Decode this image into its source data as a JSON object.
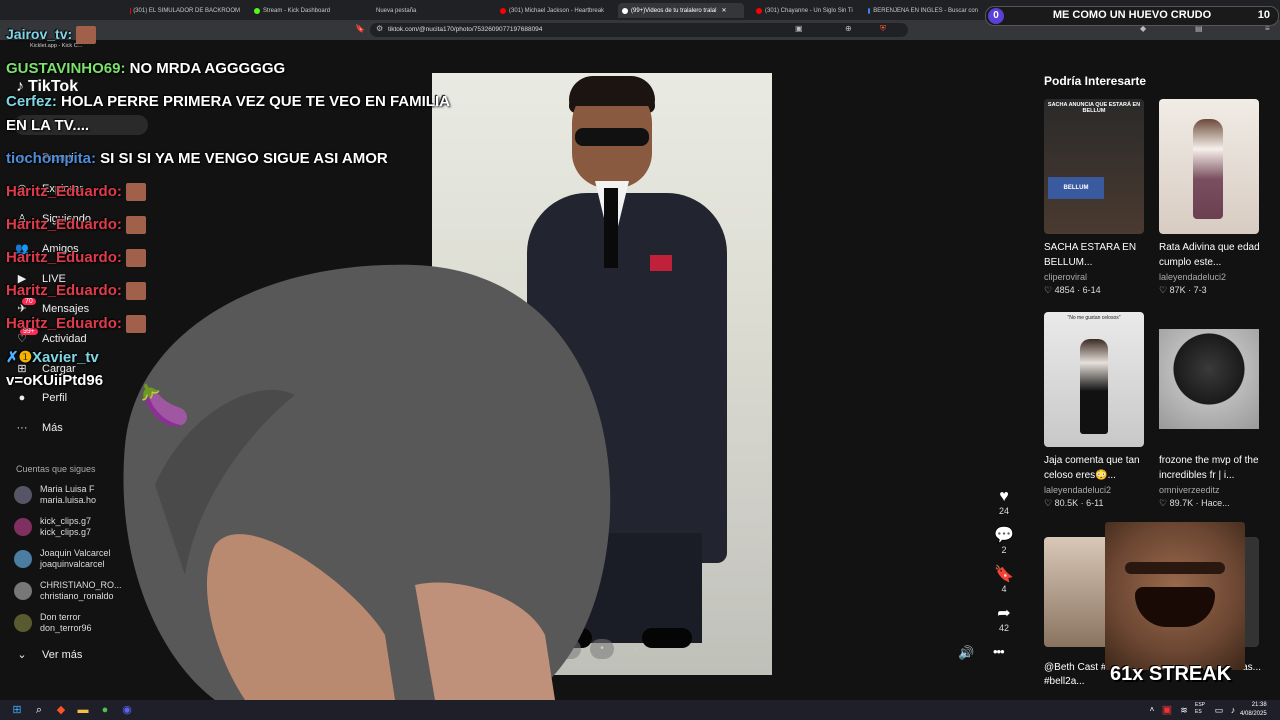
{
  "browser": {
    "tabs": [
      {
        "label": "(301) EL SIMULADOR DE BACKROOM",
        "color": "#ff0000"
      },
      {
        "label": "Stream - Kick Dashboard",
        "color": "#53fc18"
      },
      {
        "label": "Nueva pestaña",
        "color": "#888888"
      },
      {
        "label": "(301) Michael Jackson - Heartbreak",
        "color": "#ff0000"
      },
      {
        "label": "(99+)Videos de tu tralalero tralal",
        "color": "#ffffff"
      },
      {
        "label": "(301) Chayanne - Un Siglo Sin Ti",
        "color": "#ff0000"
      },
      {
        "label": "BERENJENA EN INGLES - Buscar con",
        "color": "#4285f4"
      }
    ],
    "url": "tiktok.com/@nucita170/photo/7532609077197688094"
  },
  "tiktok": {
    "logo": "TikTok",
    "nav": [
      {
        "label": "Para ti",
        "icon": "home-icon"
      },
      {
        "label": "Explorar",
        "icon": "compass-icon"
      },
      {
        "label": "Siguiendo",
        "icon": "following-icon"
      },
      {
        "label": "Amigos",
        "icon": "friends-icon"
      },
      {
        "label": "LIVE",
        "icon": "live-icon"
      },
      {
        "label": "Mensajes",
        "icon": "messages-icon",
        "badge": "70"
      },
      {
        "label": "Actividad",
        "icon": "activity-icon",
        "badge": "99+"
      },
      {
        "label": "Cargar",
        "icon": "upload-icon"
      },
      {
        "label": "Perfil",
        "icon": "profile-icon"
      },
      {
        "label": "Más",
        "icon": "more-icon"
      }
    ],
    "following_title": "Cuentas que sigues",
    "following": [
      {
        "name": "Maria Luisa F",
        "handle": "maria.luisa.ho"
      },
      {
        "name": "kick_clips.g7",
        "handle": "kick_clips.g7"
      },
      {
        "name": "Joaquin Valcarcel",
        "handle": "joaquinvalcarcel"
      },
      {
        "name": "CHRISTIANO_RO...",
        "handle": "christiano_ronaldo"
      },
      {
        "name": "Don terror",
        "handle": "don_terror96"
      }
    ],
    "see_more": "Ver más",
    "actions": {
      "likes": "24",
      "comments": "2",
      "saves": "4",
      "shares": "42"
    },
    "recommend_title": "Podría Interesarte",
    "cards": [
      {
        "title": "SACHA ESTARA EN BELLUM...",
        "author": "cliperoviral",
        "likes": "4854",
        "date": "6-14",
        "overlay": "SACHA ANUNCIA QUE ESTARÁ EN BELLUM",
        "tag": "BELLUM"
      },
      {
        "title": "Rata Adivina que edad cumplo este...",
        "author": "laleyendadeluci2",
        "likes": "87K",
        "date": "7-3"
      },
      {
        "title": "Jaja comenta que tan celoso eres😳...",
        "author": "laleyendadeluci2",
        "likes": "80.5K",
        "date": "6-11",
        "overlay": "\"No me gustan celosos\""
      },
      {
        "title": "frozone the mvp of the incredibles fr | i...",
        "author": "omniverzeeditz",
        "likes": "89.7K",
        "date": "Hace..."
      },
      {
        "title": "@Beth Cast #bethcast #bell2a...",
        "author": "",
        "likes": "",
        "date": ""
      },
      {
        "title": "#reflexion #metas...",
        "author": "",
        "likes": "",
        "date": ""
      }
    ]
  },
  "stream": {
    "chat": [
      {
        "user": "Jairov_tv:",
        "text": "",
        "color": "#7fd6e6"
      },
      {
        "user": "GUSTAVINHO69:",
        "text": "NO MRDA AGGGGGG",
        "color": "#7de16d"
      },
      {
        "user": "Cerfez:",
        "text": "HOLA PERRE PRIMERA VEZ QUE TE VEO EN FAMILIA",
        "color": "#7fd6e6"
      },
      {
        "user": "",
        "text": "EN LA TV....",
        "color": "#ffffff"
      },
      {
        "user": "tiochompita:",
        "text": "SI SI SI YA ME VENGO SIGUE ASI AMOR",
        "color": "#4e8ddb"
      },
      {
        "user": "Haritz_Eduardo:",
        "text": "",
        "color": "#e03b4b"
      },
      {
        "user": "Haritz_Eduardo:",
        "text": "",
        "color": "#e03b4b"
      },
      {
        "user": "Haritz_Eduardo:",
        "text": "",
        "color": "#e03b4b"
      },
      {
        "user": "Haritz_Eduardo:",
        "text": "",
        "color": "#e03b4b"
      },
      {
        "user": "Haritz_Eduardo:",
        "text": "",
        "color": "#e03b4b"
      },
      {
        "user": "Xavier_tv",
        "text": "",
        "color": "#7fd6e6"
      },
      {
        "user": "",
        "text": "v=oKUiiPtd96",
        "color": "#ffffff"
      }
    ],
    "goal": {
      "count_left": "0",
      "label": "ME COMO UN HUEVO CRUDO",
      "count_right": "10"
    },
    "streak": "61x STREAK",
    "eggplant": "🍆"
  },
  "taskbar": {
    "lang": "ESP\nES",
    "time": "21:38",
    "date": "4/08/2025"
  }
}
